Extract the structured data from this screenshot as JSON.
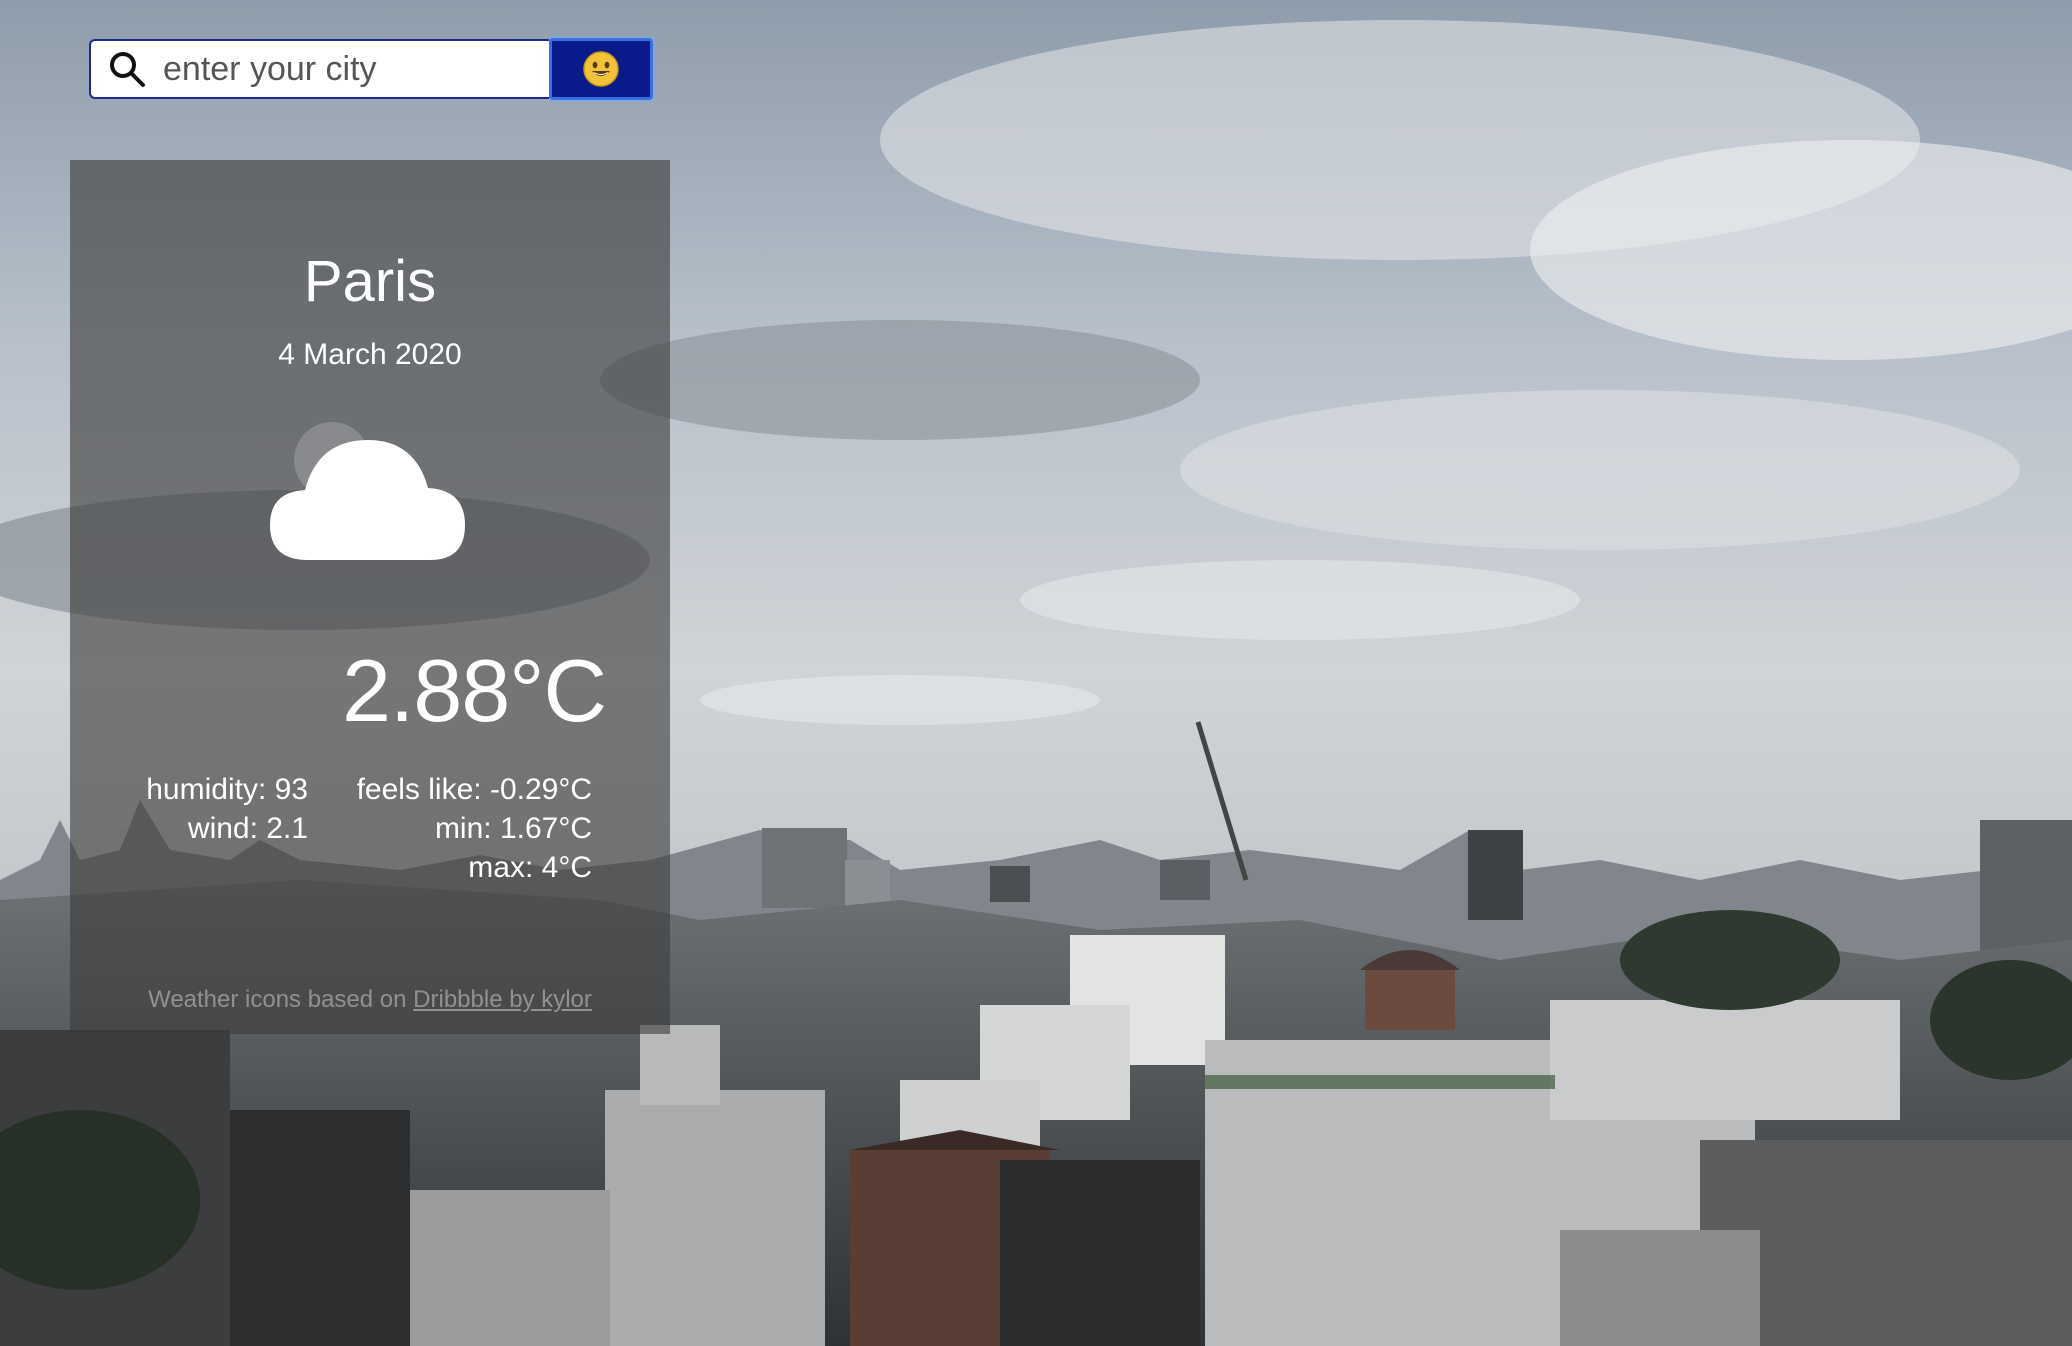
{
  "search": {
    "placeholder": "enter your city",
    "button_icon": "smiley-face"
  },
  "weather": {
    "city": "Paris",
    "date": "4 March 2020",
    "condition_icon": "cloud",
    "temperature": "2.88°C",
    "humidity": "humidity: 93",
    "wind": "wind: 2.1",
    "feels_like": "feels like: -0.29°C",
    "min": "min: 1.67°C",
    "max": "max: 4°C"
  },
  "credit": {
    "prefix": "Weather icons based on ",
    "link_text": "Dribbble by kylor"
  },
  "colors": {
    "button_bg": "#0b1a8a",
    "button_border": "#3a6fe0",
    "card_bg": "rgba(60,60,60,0.62)"
  }
}
